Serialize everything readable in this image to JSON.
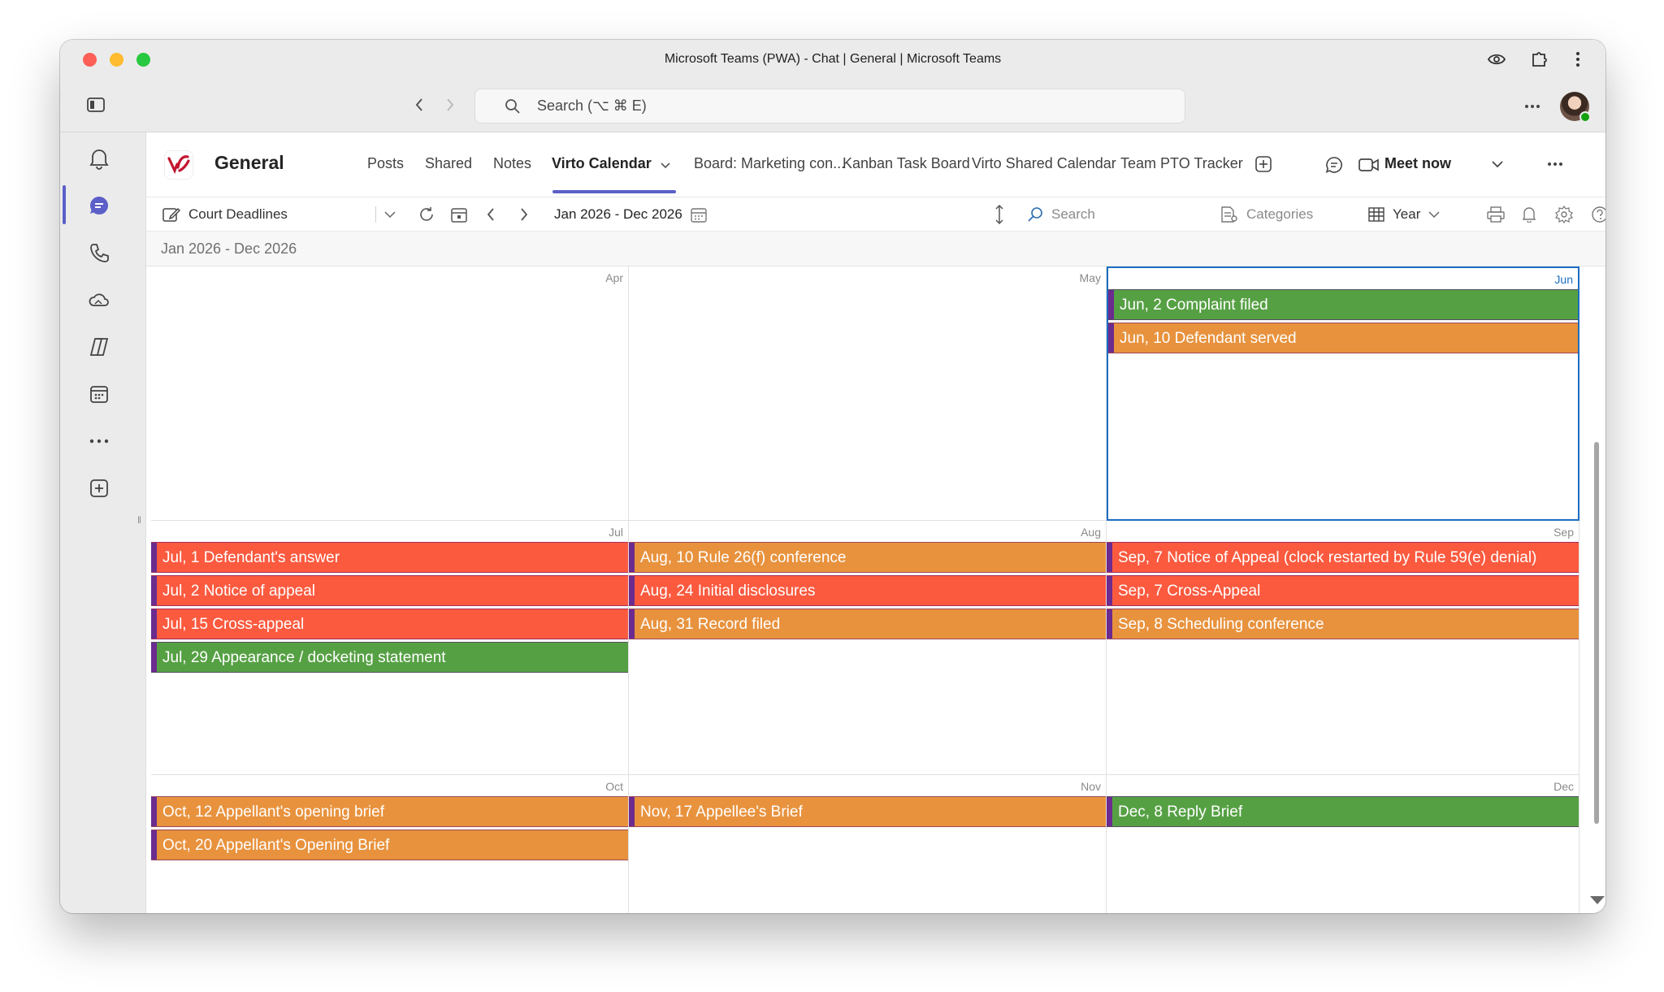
{
  "window": {
    "title": "Microsoft Teams (PWA) - Chat | General | Microsoft Teams"
  },
  "search": {
    "placeholder": "Search (⌥ ⌘ E)"
  },
  "rail": {
    "items": [
      "bell-icon",
      "chat-icon",
      "phone-icon",
      "onedrive-icon",
      "copilot-icon",
      "calendar-icon",
      "more-icon",
      "add-app-icon"
    ]
  },
  "header": {
    "team_name": "General",
    "tabs": [
      {
        "label": "Posts"
      },
      {
        "label": "Shared"
      },
      {
        "label": "Notes"
      },
      {
        "label": "Virto Calendar"
      },
      {
        "label": "Board: Marketing con..."
      },
      {
        "label": "Kanban Task Board"
      },
      {
        "label": "Virto Shared Calendar"
      },
      {
        "label": "Team PTO Tracker"
      }
    ],
    "meet_now": "Meet now"
  },
  "toolbar": {
    "calendar_name": "Court Deadlines",
    "date_range": "Jan 2026 - Dec 2026",
    "search_label": "Search",
    "categories_label": "Categories",
    "view_label": "Year"
  },
  "subheader": {
    "range": "Jan 2026 - Dec 2026"
  },
  "colors": {
    "green": "#56a044",
    "orange": "#e8923d",
    "red": "#fb5a3f",
    "selection": "#1b6ec2",
    "accent": "#5b5fc7"
  },
  "months": [
    {
      "label": "Apr",
      "selected": false,
      "events": []
    },
    {
      "label": "May",
      "selected": false,
      "events": []
    },
    {
      "label": "Jun",
      "selected": true,
      "events": [
        {
          "text": "Jun, 2 Complaint filed",
          "color": "green"
        },
        {
          "text": "Jun, 10 Defendant served",
          "color": "orange"
        }
      ]
    },
    {
      "label": "Jul",
      "selected": false,
      "events": [
        {
          "text": "Jul, 1 Defendant's answer",
          "color": "red"
        },
        {
          "text": "Jul, 2 Notice of appeal",
          "color": "red"
        },
        {
          "text": "Jul, 15 Cross-appeal",
          "color": "red"
        },
        {
          "text": "Jul, 29 Appearance / docketing statement",
          "color": "green"
        }
      ]
    },
    {
      "label": "Aug",
      "selected": false,
      "events": [
        {
          "text": "Aug, 10 Rule 26(f) conference",
          "color": "orange"
        },
        {
          "text": "Aug, 24 Initial disclosures",
          "color": "red"
        },
        {
          "text": "Aug, 31 Record filed",
          "color": "orange"
        }
      ]
    },
    {
      "label": "Sep",
      "selected": false,
      "events": [
        {
          "text": "Sep, 7 Notice of Appeal (clock restarted by Rule 59(e) denial)",
          "color": "red"
        },
        {
          "text": "Sep, 7 Cross-Appeal",
          "color": "red"
        },
        {
          "text": "Sep, 8 Scheduling conference",
          "color": "orange"
        }
      ]
    },
    {
      "label": "Oct",
      "selected": false,
      "events": [
        {
          "text": "Oct, 12 Appellant's opening brief",
          "color": "orange"
        },
        {
          "text": "Oct, 20 Appellant's Opening Brief",
          "color": "orange"
        }
      ]
    },
    {
      "label": "Nov",
      "selected": false,
      "events": [
        {
          "text": "Nov, 17 Appellee's Brief",
          "color": "orange"
        }
      ]
    },
    {
      "label": "Dec",
      "selected": false,
      "events": [
        {
          "text": "Dec, 8 Reply Brief",
          "color": "green"
        }
      ]
    }
  ]
}
